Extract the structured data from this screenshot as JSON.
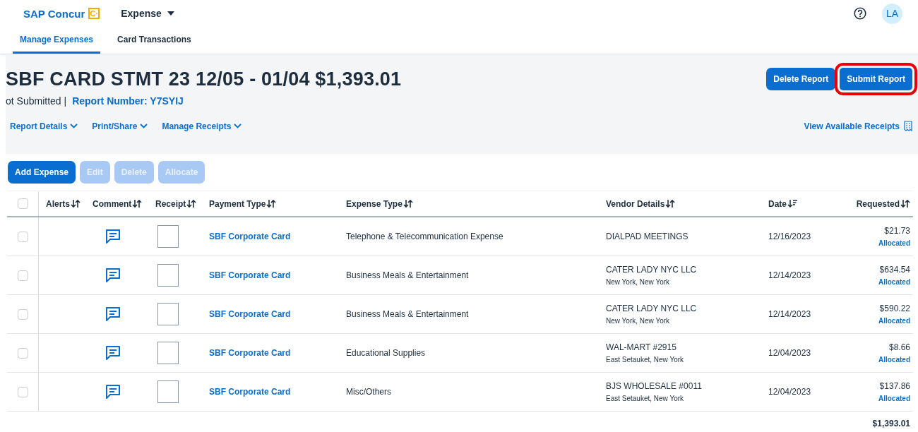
{
  "header": {
    "brand": "SAP Concur",
    "brand_mark": "C·",
    "app_menu": "Expense",
    "avatar": "LA"
  },
  "tabs": [
    {
      "label": "Manage Expenses",
      "selected": true
    },
    {
      "label": "Card Transactions",
      "selected": false
    }
  ],
  "report": {
    "title": "SBF CARD STMT 23 12/05 - 01/04 $1,393.01",
    "status": "ot Submitted |",
    "report_number": "Report Number: Y7SYIJ",
    "actions": [
      {
        "label": "Delete Report",
        "highlighted": false
      },
      {
        "label": "Submit Report",
        "highlighted": true
      }
    ],
    "menus": [
      "Report Details",
      "Print/Share",
      "Manage Receipts"
    ],
    "receipts_link": "View Available Receipts"
  },
  "toolbar": [
    {
      "label": "Add Expense",
      "disabled": false
    },
    {
      "label": "Edit",
      "disabled": true
    },
    {
      "label": "Delete",
      "disabled": true
    },
    {
      "label": "Allocate",
      "disabled": true
    }
  ],
  "table": {
    "select_all": {
      "checked": false
    },
    "columns": [
      {
        "label": "Alerts",
        "sorted": false
      },
      {
        "label": "Comment",
        "sorted": false
      },
      {
        "label": "Receipt",
        "sorted": false
      },
      {
        "label": "Payment Type",
        "sorted": false
      },
      {
        "label": "Expense Type",
        "sorted": false
      },
      {
        "label": "Vendor Details",
        "sorted": false
      },
      {
        "label": "Date",
        "sorted": true
      },
      {
        "label": "Requested",
        "sorted": false
      }
    ],
    "rows": [
      {
        "checked": false,
        "payment_type": "SBF Corporate Card",
        "expense_type": "Telephone & Telecommunication Expense",
        "vendor": "DIALPAD MEETINGS",
        "date": "12/16/2023",
        "amount": "$21.73",
        "allocation": "Allocated"
      },
      {
        "checked": false,
        "payment_type": "SBF Corporate Card",
        "expense_type": "Business Meals & Entertainment",
        "vendor": "CATER LADY NYC LLC",
        "location": "New York, New York",
        "date": "12/14/2023",
        "amount": "$634.54",
        "allocation": "Allocated"
      },
      {
        "checked": false,
        "payment_type": "SBF Corporate Card",
        "expense_type": "Business Meals & Entertainment",
        "vendor": "CATER LADY NYC LLC",
        "location": "New York, New York",
        "date": "12/14/2023",
        "amount": "$590.22",
        "allocation": "Allocated"
      },
      {
        "checked": false,
        "payment_type": "SBF Corporate Card",
        "expense_type": "Educational Supplies",
        "vendor": "WAL-MART #2915",
        "location": "East Setauket, New York",
        "date": "12/04/2023",
        "amount": "$8.66",
        "allocation": "Allocated"
      },
      {
        "checked": false,
        "payment_type": "SBF Corporate Card",
        "expense_type": "Misc/Others",
        "vendor": "BJS WHOLESALE #0011",
        "location": "East Setauket, New York",
        "date": "12/04/2023",
        "amount": "$137.86",
        "allocation": "Allocated"
      }
    ],
    "total": "$1,393.01"
  }
}
